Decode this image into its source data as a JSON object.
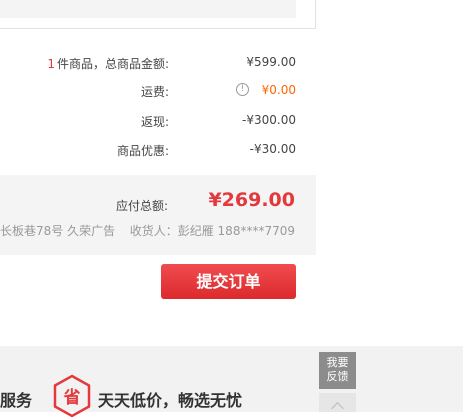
{
  "summary": {
    "count": "1",
    "count_suffix": "件商品，总商品金额:",
    "subtotal_value": "¥599.00",
    "shipping_label": "运费:",
    "shipping_value": "¥0.00",
    "cashback_label": "返现:",
    "cashback_value": "-¥300.00",
    "discount_label": "商品优惠:",
    "discount_value": "-¥30.00"
  },
  "total": {
    "label": "应付总额:",
    "amount": "¥269.00",
    "address": "长板巷78号 久荣广告",
    "receiver": "收货人：彭纪雁 188****7709"
  },
  "actions": {
    "submit": "提交订单"
  },
  "footer": {
    "service": "服务",
    "save_icon_char": "省",
    "slogan": "天天低价，畅选无忧"
  },
  "sidebar": {
    "feedback_line1": "我要",
    "feedback_line2": "反馈"
  },
  "colors": {
    "accent_red": "#e4393c",
    "shipping_orange": "#ff6600"
  },
  "icons": {
    "info": "info-circle-icon",
    "save": "save-hexagon-icon",
    "back_to_top": "chevron-up-icon"
  }
}
